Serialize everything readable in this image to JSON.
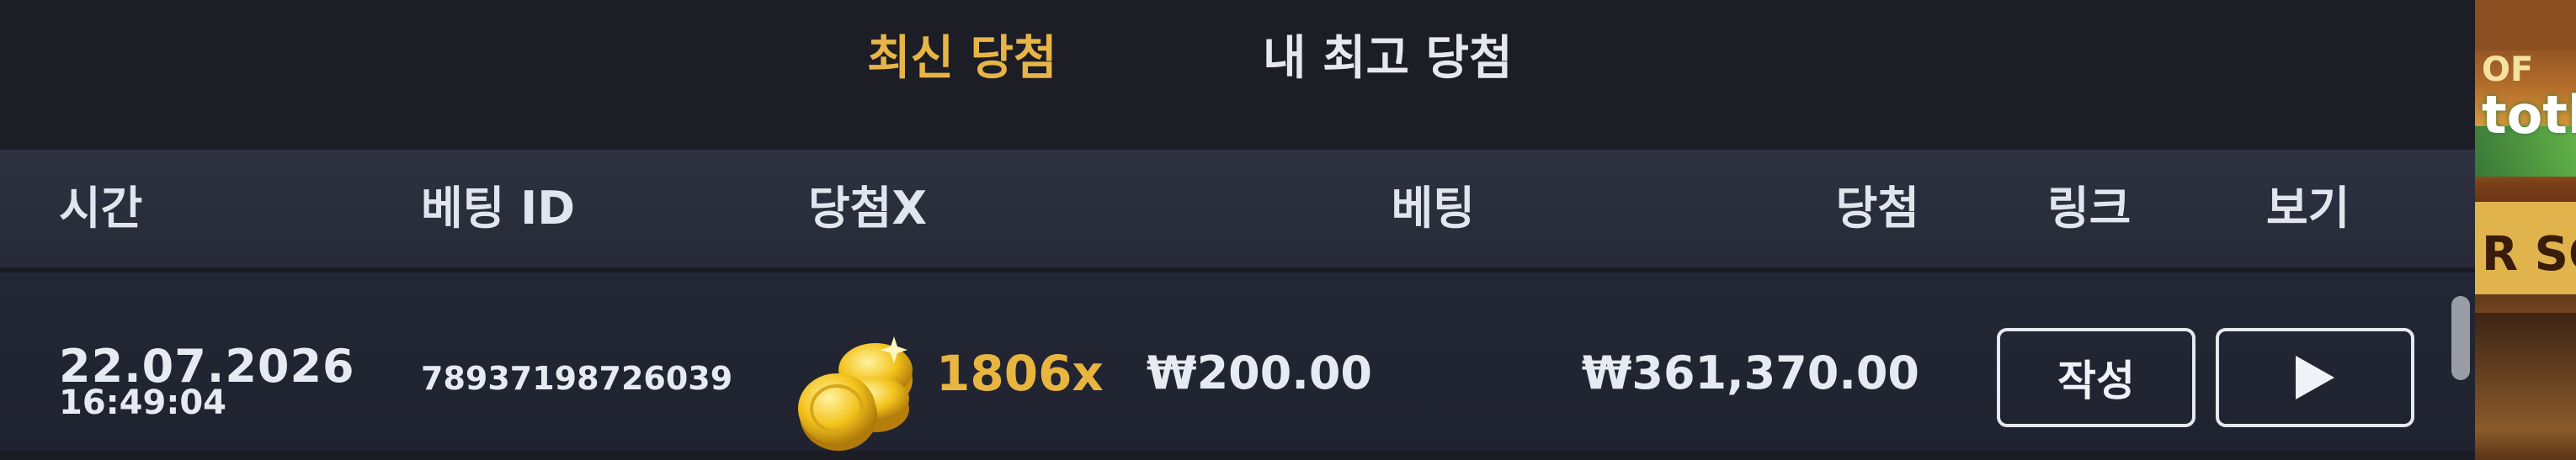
{
  "tabs": {
    "latest": "최신 당첨",
    "my_best": "내 최고 당첨"
  },
  "table": {
    "headers": {
      "time": "시간",
      "bet_id": "베팅 ID",
      "multiplier": "당첨X",
      "bet": "베팅",
      "win": "당첨",
      "link": "링크",
      "view": "보기"
    },
    "rows": [
      {
        "date": "22.07.2026",
        "time": "16:49:04",
        "bet_id": "78937198726039",
        "multiplier": "1806x",
        "bet": "₩200.00",
        "win": "₩361,370.00",
        "link_label": "작성",
        "view_icon": "play-icon"
      }
    ]
  },
  "side_art": {
    "text_top": "OF",
    "text_mid": "toth",
    "text_low": "R SC"
  },
  "colors": {
    "accent": "#e7b547",
    "background": "#1c1c24",
    "header_bg": "#2e3140"
  }
}
